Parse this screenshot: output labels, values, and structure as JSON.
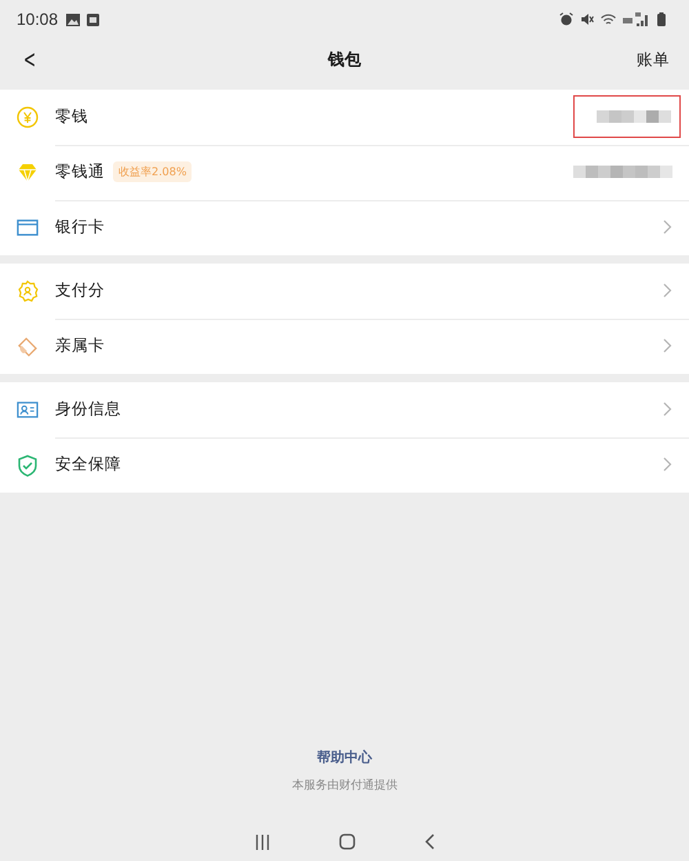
{
  "status_bar": {
    "time": "10:08"
  },
  "nav": {
    "back": "<",
    "title": "钱包",
    "action": "账单"
  },
  "groups": [
    {
      "rows": [
        {
          "kind": "amount",
          "label": "零钱",
          "highlighted": true
        },
        {
          "kind": "amount",
          "label": "零钱通",
          "badge": "收益率2.08%",
          "highlighted": false
        },
        {
          "kind": "link",
          "label": "银行卡"
        }
      ]
    },
    {
      "rows": [
        {
          "kind": "link",
          "label": "支付分"
        },
        {
          "kind": "link",
          "label": "亲属卡"
        }
      ]
    },
    {
      "rows": [
        {
          "kind": "link",
          "label": "身份信息"
        },
        {
          "kind": "link",
          "label": "安全保障"
        }
      ]
    }
  ],
  "footer": {
    "link": "帮助中心",
    "note": "本服务由财付通提供"
  }
}
